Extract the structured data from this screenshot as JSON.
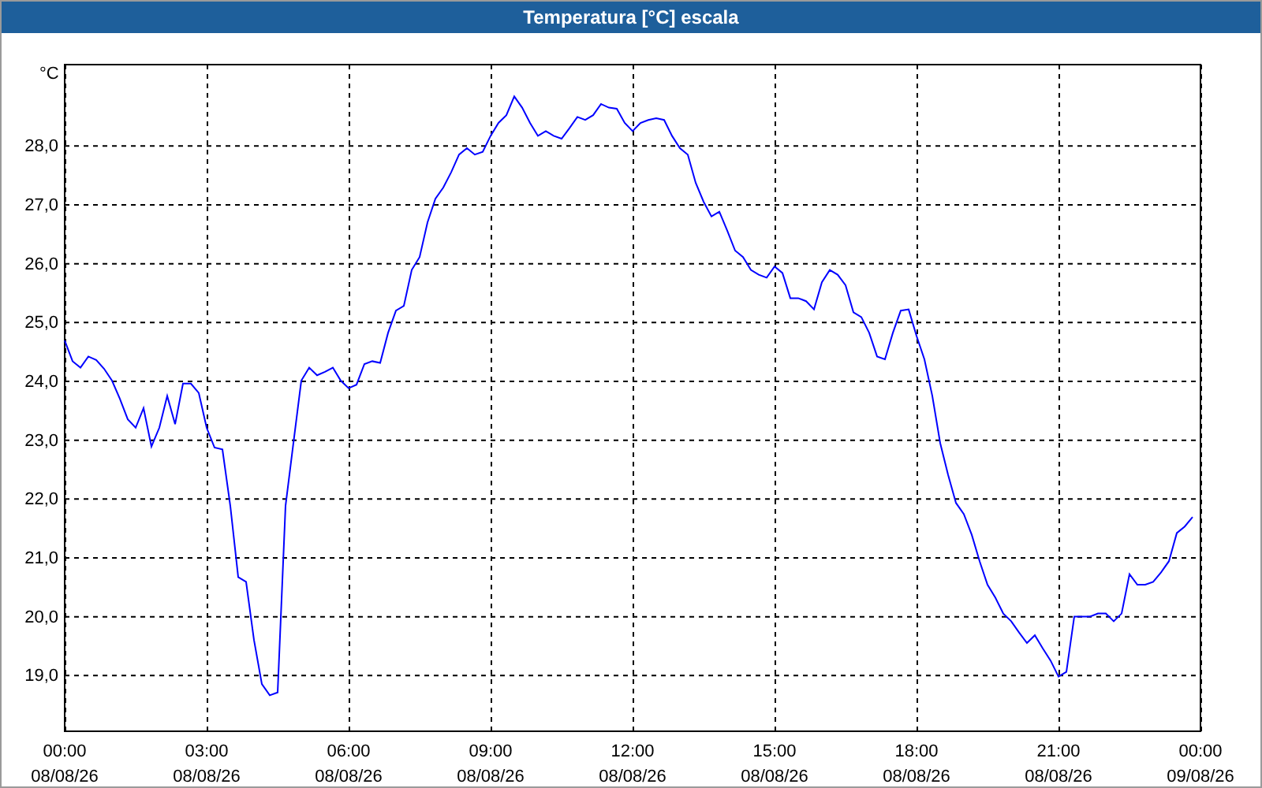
{
  "window": {
    "title": "Temperatura [°C] escala"
  },
  "chart": {
    "chart_data": {
      "type": "line",
      "ylabel": "°C",
      "categories": [
        "00:00\n08/08/26",
        null,
        null,
        null,
        null,
        null,
        null,
        null,
        null,
        null,
        null,
        null,
        null,
        null,
        null,
        null,
        null,
        null,
        "03:00\n08/08/26",
        null,
        null,
        null,
        null,
        null,
        null,
        null,
        null,
        null,
        null,
        null,
        null,
        null,
        null,
        null,
        null,
        null,
        "06:00\n08/08/26",
        null,
        null,
        null,
        null,
        null,
        null,
        null,
        null,
        null,
        null,
        null,
        null,
        null,
        null,
        null,
        null,
        null,
        "09:00\n08/08/26",
        null,
        null,
        null,
        null,
        null,
        null,
        null,
        null,
        null,
        null,
        null,
        null,
        null,
        null,
        null,
        null,
        null,
        "12:00\n08/08/26",
        null,
        null,
        null,
        null,
        null,
        null,
        null,
        null,
        null,
        null,
        null,
        null,
        null,
        null,
        null,
        null,
        null,
        "15:00\n08/08/26",
        null,
        null,
        null,
        null,
        null,
        null,
        null,
        null,
        null,
        null,
        null,
        null,
        null,
        null,
        null,
        null,
        null,
        "18:00\n08/08/26",
        null,
        null,
        null,
        null,
        null,
        null,
        null,
        null,
        null,
        null,
        null,
        null,
        null,
        null,
        null,
        null,
        null,
        "21:00\n08/08/26",
        null,
        null,
        null,
        null,
        null,
        null,
        null,
        null,
        null,
        null,
        null,
        null,
        null,
        null,
        null,
        null,
        null,
        "00:00\n09/08/26"
      ],
      "series": [
        {
          "color": "#0000ff",
          "values": [
            24.68,
            24.33,
            24.22,
            24.41,
            24.35,
            24.2,
            24.0,
            23.69,
            23.34,
            23.2,
            23.53,
            22.88,
            23.2,
            23.74,
            23.26,
            23.95,
            23.95,
            23.79,
            23.2,
            22.86,
            22.83,
            21.87,
            20.66,
            20.58,
            19.59,
            18.84,
            18.65,
            18.7,
            21.87,
            22.94,
            24.0,
            24.22,
            24.09,
            24.15,
            24.22,
            24.0,
            23.87,
            23.93,
            24.28,
            24.33,
            24.3,
            24.81,
            25.19,
            25.27,
            25.88,
            26.1,
            26.69,
            27.09,
            27.28,
            27.54,
            27.84,
            27.95,
            27.84,
            27.89,
            28.16,
            28.38,
            28.51,
            28.83,
            28.64,
            28.38,
            28.16,
            28.24,
            28.16,
            28.11,
            28.29,
            28.48,
            28.43,
            28.51,
            28.7,
            28.64,
            28.62,
            28.38,
            28.24,
            28.38,
            28.43,
            28.46,
            28.43,
            28.16,
            27.95,
            27.84,
            27.36,
            27.04,
            26.79,
            26.87,
            26.55,
            26.21,
            26.1,
            25.88,
            25.8,
            25.75,
            25.94,
            25.83,
            25.4,
            25.4,
            25.35,
            25.21,
            25.67,
            25.88,
            25.8,
            25.62,
            25.16,
            25.08,
            24.81,
            24.41,
            24.36,
            24.81,
            25.19,
            25.21,
            24.76,
            24.36,
            23.74,
            22.94,
            22.4,
            21.92,
            21.73,
            21.38,
            20.93,
            20.53,
            20.31,
            20.04,
            19.91,
            19.72,
            19.54,
            19.67,
            19.45,
            19.24,
            18.97,
            19.05,
            19.99,
            19.99,
            19.99,
            20.04,
            20.04,
            19.91,
            20.04,
            20.71,
            20.53,
            20.53,
            20.58,
            20.74,
            20.93,
            21.41,
            21.52,
            21.68,
            null
          ]
        }
      ],
      "ylim": [
        18.04,
        29.37
      ],
      "grid": true,
      "yticks": [
        {
          "value": 19,
          "label": "19,0"
        },
        {
          "value": 20,
          "label": "20,0"
        },
        {
          "value": 21,
          "label": "21,0"
        },
        {
          "value": 22,
          "label": "22,0"
        },
        {
          "value": 23,
          "label": "23,0"
        },
        {
          "value": 24,
          "label": "24,0"
        },
        {
          "value": 25,
          "label": "25,0"
        },
        {
          "value": 26,
          "label": "26,0"
        },
        {
          "value": 27,
          "label": "27,0"
        },
        {
          "value": 28,
          "label": "28,0"
        }
      ]
    }
  }
}
